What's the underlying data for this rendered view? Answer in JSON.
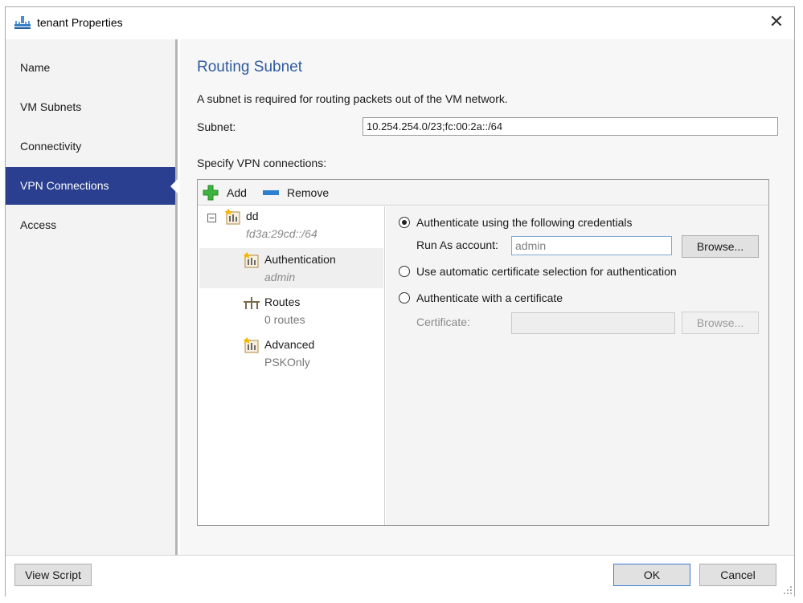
{
  "window": {
    "title": "tenant Properties",
    "close_glyph": "✕"
  },
  "sidebar": {
    "items": [
      {
        "label": "Name"
      },
      {
        "label": "VM Subnets"
      },
      {
        "label": "Connectivity"
      },
      {
        "label": "VPN Connections",
        "active": true
      },
      {
        "label": "Access"
      }
    ]
  },
  "main": {
    "heading": "Routing Subnet",
    "description": "A subnet is required for routing packets out of the VM network.",
    "subnet_label": "Subnet:",
    "subnet_value": "10.254.254.0/23;fc:00:2a::/64",
    "vpn_label": "Specify VPN connections:",
    "toolbar": {
      "add_label": "Add",
      "remove_label": "Remove"
    },
    "tree": {
      "root": {
        "title": "dd",
        "subtitle": "fd3a:29cd::/64",
        "expander": "−"
      },
      "children": [
        {
          "title": "Authentication",
          "subtitle": "admin",
          "selected": true,
          "icon": "connection-icon"
        },
        {
          "title": "Routes",
          "subtitle": "0 routes",
          "icon": "routes-icon"
        },
        {
          "title": "Advanced",
          "subtitle": "PSKOnly",
          "icon": "connection-icon"
        }
      ]
    },
    "auth": {
      "option_credentials": "Authenticate using the following credentials",
      "run_as_label": "Run As account:",
      "run_as_value": "admin",
      "browse_label": "Browse...",
      "option_auto_cert": "Use automatic certificate selection for authentication",
      "option_cert": "Authenticate with a certificate",
      "certificate_label": "Certificate:",
      "certificate_value": "",
      "browse_cert_label": "Browse...",
      "selected_option": "credentials"
    }
  },
  "footer": {
    "view_script_label": "View Script",
    "ok_label": "OK",
    "cancel_label": "Cancel"
  },
  "colors": {
    "accent": "#2a3f8f",
    "heading": "#2e5a9e",
    "add_icon": "#3cb33c",
    "remove_icon": "#2f7fd0"
  }
}
